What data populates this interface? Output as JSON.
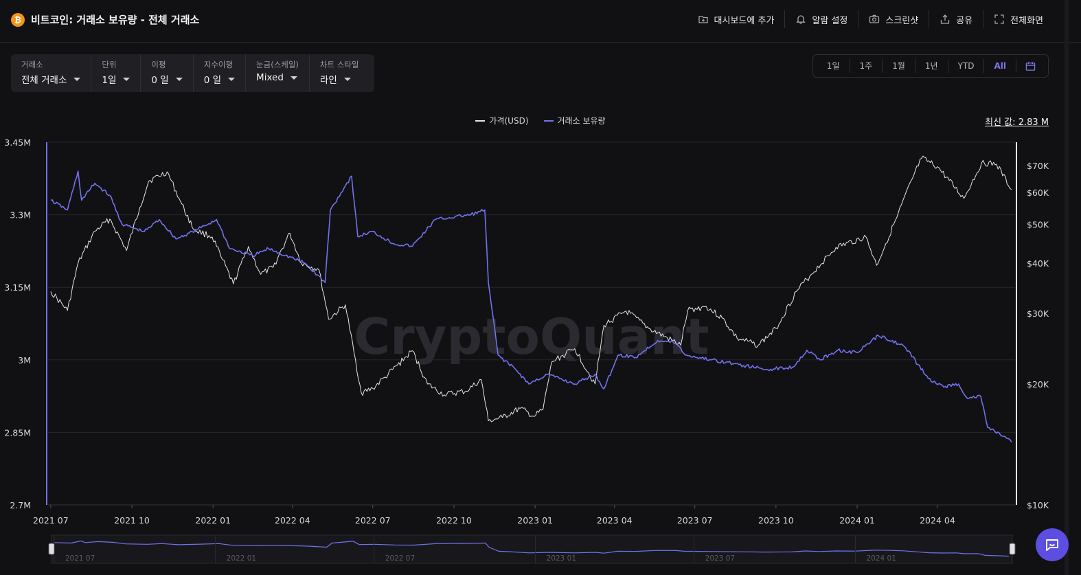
{
  "header": {
    "title": "비트코인: 거래소 보유량 - 전체 거래소",
    "coin_icon_glyph": "₿",
    "actions": [
      {
        "label": "대시보드에 추가",
        "icon": "dashboard-add-icon"
      },
      {
        "label": "알람 설정",
        "icon": "bell-icon"
      },
      {
        "label": "스크린샷",
        "icon": "camera-icon"
      },
      {
        "label": "공유",
        "icon": "share-icon"
      },
      {
        "label": "전체화면",
        "icon": "fullscreen-icon"
      }
    ]
  },
  "filters": [
    {
      "label": "거래소",
      "value": "전체 거래소"
    },
    {
      "label": "단위",
      "value": "1일"
    },
    {
      "label": "이평",
      "value": "0 일"
    },
    {
      "label": "지수이평",
      "value": "0 일"
    },
    {
      "label": "눈금(스케일)",
      "value": "Mixed"
    },
    {
      "label": "차트 스타일",
      "value": "라인"
    }
  ],
  "range": {
    "buttons": [
      "1일",
      "1주",
      "1월",
      "1년",
      "YTD",
      "All"
    ],
    "active": "All",
    "calendar_icon": "calendar-icon"
  },
  "legend": [
    {
      "name": "가격(USD)",
      "color": "#e8e8e8"
    },
    {
      "name": "거래소 보유량",
      "color": "#7372ef"
    }
  ],
  "latest_value": "최신 값: 2.83 M",
  "watermark": "CryptoQuant",
  "chart_data": {
    "type": "line",
    "x_ticks": [
      "2021 07",
      "2021 10",
      "2022 01",
      "2022 04",
      "2022 07",
      "2022 10",
      "2023 01",
      "2023 04",
      "2023 07",
      "2023 10",
      "2024 01",
      "2024 04"
    ],
    "y_left": {
      "ticks": [
        "3.45M",
        "3.3M",
        "3.15M",
        "3M",
        "2.85M",
        "2.7M"
      ],
      "range": [
        2700000,
        3450000
      ]
    },
    "y_right": {
      "scale": "log",
      "ticks": [
        "$70K",
        "$60K",
        "$50K",
        "$40K",
        "$30K",
        "$20K",
        "$10K"
      ],
      "tick_values": [
        70000,
        60000,
        50000,
        40000,
        30000,
        20000,
        10000
      ],
      "range": [
        10000,
        80000
      ]
    },
    "series": [
      {
        "name": "가격(USD)",
        "axis": "right",
        "color": "#e8e8e8",
        "points": [
          [
            "2021-07-01",
            34000
          ],
          [
            "2021-07-20",
            30500
          ],
          [
            "2021-08-01",
            40000
          ],
          [
            "2021-08-20",
            48000
          ],
          [
            "2021-09-06",
            51500
          ],
          [
            "2021-09-25",
            43000
          ],
          [
            "2021-10-10",
            55000
          ],
          [
            "2021-10-20",
            64000
          ],
          [
            "2021-11-10",
            67500
          ],
          [
            "2021-11-25",
            57000
          ],
          [
            "2021-12-10",
            48500
          ],
          [
            "2021-12-31",
            46500
          ],
          [
            "2022-01-10",
            41500
          ],
          [
            "2022-01-24",
            35500
          ],
          [
            "2022-02-10",
            44000
          ],
          [
            "2022-02-24",
            37500
          ],
          [
            "2022-03-10",
            39000
          ],
          [
            "2022-03-29",
            47500
          ],
          [
            "2022-04-11",
            40000
          ],
          [
            "2022-05-01",
            38500
          ],
          [
            "2022-05-12",
            29000
          ],
          [
            "2022-05-31",
            31500
          ],
          [
            "2022-06-18",
            19000
          ],
          [
            "2022-07-01",
            19500
          ],
          [
            "2022-07-15",
            20800
          ],
          [
            "2022-08-15",
            24200
          ],
          [
            "2022-09-01",
            20000
          ],
          [
            "2022-09-20",
            18800
          ],
          [
            "2022-10-15",
            19200
          ],
          [
            "2022-11-01",
            20500
          ],
          [
            "2022-11-09",
            16200
          ],
          [
            "2022-11-25",
            16500
          ],
          [
            "2022-12-15",
            17400
          ],
          [
            "2022-12-31",
            16600
          ],
          [
            "2023-01-10",
            17300
          ],
          [
            "2023-01-20",
            22700
          ],
          [
            "2023-02-15",
            24500
          ],
          [
            "2023-03-10",
            20000
          ],
          [
            "2023-03-20",
            28000
          ],
          [
            "2023-04-14",
            30400
          ],
          [
            "2023-05-10",
            27500
          ],
          [
            "2023-06-15",
            25000
          ],
          [
            "2023-06-23",
            30500
          ],
          [
            "2023-07-14",
            31200
          ],
          [
            "2023-08-01",
            29200
          ],
          [
            "2023-08-18",
            26000
          ],
          [
            "2023-09-11",
            25000
          ],
          [
            "2023-10-01",
            27500
          ],
          [
            "2023-10-24",
            34000
          ],
          [
            "2023-11-10",
            37500
          ],
          [
            "2023-12-08",
            43800
          ],
          [
            "2024-01-11",
            46500
          ],
          [
            "2024-01-23",
            39500
          ],
          [
            "2024-02-15",
            52000
          ],
          [
            "2024-03-05",
            66000
          ],
          [
            "2024-03-14",
            73000
          ],
          [
            "2024-04-01",
            69500
          ],
          [
            "2024-05-01",
            58000
          ],
          [
            "2024-05-21",
            71000
          ],
          [
            "2024-06-07",
            70500
          ],
          [
            "2024-06-24",
            61000
          ]
        ]
      },
      {
        "name": "거래소 보유량",
        "axis": "left",
        "color": "#7372ef",
        "points": [
          [
            "2021-07-01",
            3330000
          ],
          [
            "2021-07-20",
            3310000
          ],
          [
            "2021-08-01",
            3390000
          ],
          [
            "2021-08-05",
            3330000
          ],
          [
            "2021-08-20",
            3365000
          ],
          [
            "2021-09-06",
            3340000
          ],
          [
            "2021-09-20",
            3280000
          ],
          [
            "2021-10-15",
            3265000
          ],
          [
            "2021-11-01",
            3290000
          ],
          [
            "2021-11-20",
            3250000
          ],
          [
            "2021-12-15",
            3270000
          ],
          [
            "2022-01-05",
            3290000
          ],
          [
            "2022-01-20",
            3230000
          ],
          [
            "2022-02-15",
            3215000
          ],
          [
            "2022-03-05",
            3230000
          ],
          [
            "2022-04-15",
            3200000
          ],
          [
            "2022-05-08",
            3160000
          ],
          [
            "2022-05-14",
            3310000
          ],
          [
            "2022-05-31",
            3360000
          ],
          [
            "2022-06-07",
            3380000
          ],
          [
            "2022-06-14",
            3255000
          ],
          [
            "2022-07-01",
            3265000
          ],
          [
            "2022-07-25",
            3240000
          ],
          [
            "2022-08-15",
            3235000
          ],
          [
            "2022-09-10",
            3290000
          ],
          [
            "2022-10-20",
            3300000
          ],
          [
            "2022-11-05",
            3310000
          ],
          [
            "2022-11-09",
            3160000
          ],
          [
            "2022-11-20",
            3010000
          ],
          [
            "2022-12-10",
            2980000
          ],
          [
            "2022-12-25",
            2950000
          ],
          [
            "2023-01-15",
            2970000
          ],
          [
            "2023-02-15",
            2950000
          ],
          [
            "2023-03-10",
            2970000
          ],
          [
            "2023-03-20",
            2940000
          ],
          [
            "2023-04-05",
            3010000
          ],
          [
            "2023-04-25",
            3005000
          ],
          [
            "2023-05-20",
            3040000
          ],
          [
            "2023-06-10",
            3035000
          ],
          [
            "2023-06-20",
            3010000
          ],
          [
            "2023-07-20",
            3000000
          ],
          [
            "2023-08-20",
            2990000
          ],
          [
            "2023-09-20",
            2980000
          ],
          [
            "2023-10-20",
            2985000
          ],
          [
            "2023-11-05",
            3020000
          ],
          [
            "2023-11-20",
            3000000
          ],
          [
            "2023-12-10",
            3020000
          ],
          [
            "2024-01-01",
            3015000
          ],
          [
            "2024-01-25",
            3050000
          ],
          [
            "2024-02-10",
            3040000
          ],
          [
            "2024-02-25",
            3025000
          ],
          [
            "2024-03-10",
            2990000
          ],
          [
            "2024-03-25",
            2955000
          ],
          [
            "2024-04-10",
            2945000
          ],
          [
            "2024-04-25",
            2950000
          ],
          [
            "2024-05-05",
            2920000
          ],
          [
            "2024-05-20",
            2925000
          ],
          [
            "2024-05-28",
            2860000
          ],
          [
            "2024-06-15",
            2842000
          ],
          [
            "2024-06-24",
            2830000
          ]
        ]
      }
    ]
  }
}
